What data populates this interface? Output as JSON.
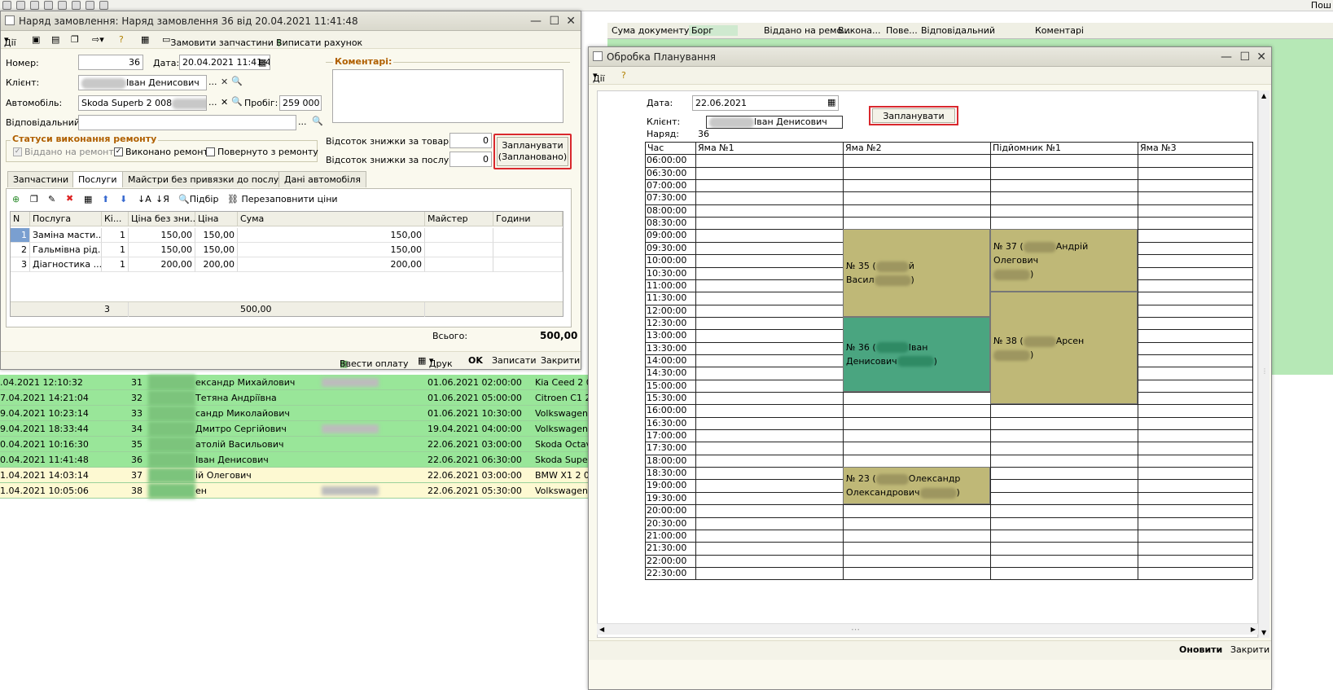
{
  "bg": {
    "top_right": "Пош",
    "headers": [
      "Сума документу",
      "Борг",
      "Віддано на ремо...",
      "Викона...",
      "Пове...",
      "Відповідальний",
      "Коментарі"
    ],
    "rows": [
      {
        "date": ".04.2021 12:10:32",
        "num": "31",
        "client": "ександр Михайлович",
        "planned": "01.06.2021 02:00:00",
        "car": "Kia Ceed 2 00"
      },
      {
        "date": "7.04.2021 14:21:04",
        "num": "32",
        "client": "Тетяна Андріївна",
        "planned": "01.06.2021 05:00:00",
        "car": "Citroen C1 2 0"
      },
      {
        "date": "9.04.2021 10:23:14",
        "num": "33",
        "client": "сандр Миколайович",
        "planned": "01.06.2021 10:30:00",
        "car": "Volkswagen F"
      },
      {
        "date": "9.04.2021 18:33:44",
        "num": "34",
        "client": "Дмитро Сергійович",
        "planned": "19.04.2021 04:00:00",
        "car": "Volkswagen T"
      },
      {
        "date": "0.04.2021 10:16:30",
        "num": "35",
        "client": "атолій Васильович",
        "planned": "22.06.2021 03:00:00",
        "car": "Skoda Octavi"
      },
      {
        "date": "0.04.2021 11:41:48",
        "num": "36",
        "client": "Іван Денисович",
        "planned": "22.06.2021 06:30:00",
        "car": "Skoda Superb"
      },
      {
        "date": "1.04.2021 14:03:14",
        "num": "37",
        "client": "ій Олегович",
        "planned": "22.06.2021 03:00:00",
        "car": "BMW X1 2 01"
      },
      {
        "date": "1.04.2021 10:05:06",
        "num": "38",
        "client": "ен",
        "planned": "22.06.2021 05:30:00",
        "car": "Volkswagen C"
      }
    ]
  },
  "order": {
    "title": "Наряд замовлення: Наряд замовлення 36 від 20.04.2021 11:41:48",
    "toolbar": {
      "actions": "Дії",
      "order_parts": "Замовити запчастини",
      "issue_invoice": "Виписати рахунок"
    },
    "number_label": "Номер:",
    "number": "36",
    "date_label": "Дата:",
    "date": "20.04.2021 11:41:4",
    "client_label": "Клієнт:",
    "client": "Іван Денисович",
    "car_label": "Автомобіль:",
    "car": "Skoda Superb 2 008",
    "mileage_label": "Пробіг:",
    "mileage": "259 000",
    "responsible_label": "Відповідальний:",
    "responsible": "",
    "comments_label": "Коментарі:",
    "status_group": "Статуси виконання ремонту",
    "status": [
      {
        "label": "Віддано на ремонт",
        "checked": true,
        "disabled": true
      },
      {
        "label": "Виконано ремонт",
        "checked": true,
        "disabled": false
      },
      {
        "label": "Повернуто з ремонту",
        "checked": false,
        "disabled": false
      }
    ],
    "discount_goods_label": "Відсоток знижки за товари:",
    "discount_goods": "0",
    "discount_services_label": "Відсоток знижки за послуги:",
    "discount_services": "0",
    "plan_button_line1": "Запланувати",
    "plan_button_line2": "(Заплановано)",
    "tabs": [
      "Запчастини",
      "Послуги",
      "Майстри без привязки до послуг",
      "Дані автомобіля"
    ],
    "grid_toolbar": {
      "pick": "Підбір",
      "refill": "Перезаповнити ціни"
    },
    "columns": [
      "N",
      "Послуга",
      "Кі...",
      "Ціна без зни...",
      "Ціна",
      "Сума",
      "Майстер",
      "Години"
    ],
    "services": [
      {
        "n": "1",
        "name": "Заміна масти...",
        "qty": "1",
        "price_nodisc": "150,00",
        "price": "150,00",
        "sum": "150,00"
      },
      {
        "n": "2",
        "name": "Гальмівна рід...",
        "qty": "1",
        "price_nodisc": "150,00",
        "price": "150,00",
        "sum": "150,00"
      },
      {
        "n": "3",
        "name": "Діагностика ...",
        "qty": "1",
        "price_nodisc": "200,00",
        "price": "200,00",
        "sum": "200,00"
      }
    ],
    "footer_qty": "3",
    "footer_sum": "500,00",
    "total_label": "Всього:",
    "total": "500,00",
    "bottom": {
      "pay": "Ввести оплату",
      "print": "Друк",
      "ok": "OK",
      "save": "Записати",
      "close": "Закрити"
    }
  },
  "planning": {
    "title": "Обробка  Планування",
    "actions": "Дії",
    "date_label": "Дата:",
    "date": "22.06.2021",
    "client_label": "Клієнт:",
    "client": "Іван Денисович",
    "order_label": "Наряд:",
    "order": "36",
    "plan_button": "Запланувати",
    "headers": [
      "Час",
      "Яма №1",
      "Яма №2",
      "Підйомник №1",
      "Яма №3"
    ],
    "times": [
      "06:00:00",
      "06:30:00",
      "07:00:00",
      "07:30:00",
      "08:00:00",
      "08:30:00",
      "09:00:00",
      "09:30:00",
      "10:00:00",
      "10:30:00",
      "11:00:00",
      "11:30:00",
      "12:00:00",
      "12:30:00",
      "13:00:00",
      "13:30:00",
      "14:00:00",
      "14:30:00",
      "15:00:00",
      "15:30:00",
      "16:00:00",
      "16:30:00",
      "17:00:00",
      "17:30:00",
      "18:00:00",
      "18:30:00",
      "19:00:00",
      "19:30:00",
      "20:00:00",
      "20:30:00",
      "21:00:00",
      "21:30:00",
      "22:00:00",
      "22:30:00"
    ],
    "bookings": [
      {
        "col": 2,
        "start": "09:00:00",
        "end": "12:30:00",
        "l1a": "№ 35 (",
        "l1b": "й",
        "l2a": "Васил",
        "l2b": ")",
        "color": "#bfb877"
      },
      {
        "col": 2,
        "start": "12:30:00",
        "end": "15:30:00",
        "l1a": "№ 36 (",
        "l1b": "Іван",
        "l2a": "Денисович",
        "l2b": ")",
        "color": "#4aa580"
      },
      {
        "col": 3,
        "start": "09:00:00",
        "end": "11:30:00",
        "l1a": "№ 37 (",
        "l1b": "Андрій Олегович",
        "l2a": "",
        "l2b": ")",
        "color": "#bfb877"
      },
      {
        "col": 3,
        "start": "11:30:00",
        "end": "16:00:00",
        "l1a": "№ 38 (",
        "l1b": "Арсен",
        "l2a": "",
        "l2b": ")",
        "color": "#bfb877"
      },
      {
        "col": 2,
        "start": "18:30:00",
        "end": "20:00:00",
        "l1a": "№ 23 (",
        "l1b": "Олександр",
        "l2a": "Олександрович",
        "l2b": ")",
        "color": "#bfb877"
      }
    ],
    "bottom": {
      "refresh": "Оновити",
      "close": "Закрити"
    }
  }
}
